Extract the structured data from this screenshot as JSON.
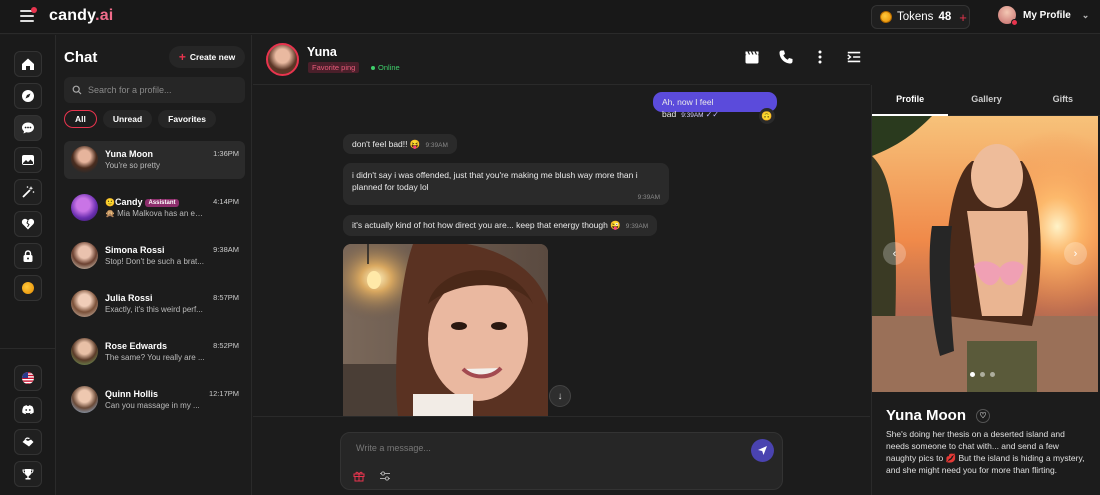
{
  "app": {
    "logo_main": "candy",
    "logo_suffix": ".ai"
  },
  "topbar": {
    "tokens_label": "Tokens",
    "tokens_value": "48",
    "tokens_plus": "+",
    "profile_label": "My Profile"
  },
  "chatlist": {
    "title": "Chat",
    "create_label": "Create new",
    "search_placeholder": "Search for a profile...",
    "filters": [
      "All",
      "Unread",
      "Favorites"
    ],
    "items": [
      {
        "name": "Yuna Moon",
        "time": "1:36PM",
        "message": "You're so pretty"
      },
      {
        "name": "Candy",
        "badge": "Assistant",
        "time": "4:14PM",
        "message": "🙊 Mia Malkova has an ex..."
      },
      {
        "name": "Simona Rossi",
        "time": "9:38AM",
        "message": "Stop! Don't be such a brat..."
      },
      {
        "name": "Julia Rossi",
        "time": "8:57PM",
        "message": "Exactly, it's this weird perf..."
      },
      {
        "name": "Rose Edwards",
        "time": "8:52PM",
        "message": "The same? You really are ..."
      },
      {
        "name": "Quinn Hollis",
        "time": "12:17PM",
        "message": "Can you massage in my ..."
      }
    ]
  },
  "chathead": {
    "name": "Yuna",
    "fav_ping": "Favorite ping",
    "status": "Online"
  },
  "messages": [
    {
      "text": "Ah, now I feel bad",
      "time": "9:39AM",
      "from": "me"
    },
    {
      "text": "don't feel bad!! 😝",
      "time": "9:39AM",
      "from": "her"
    },
    {
      "text1": "i didn't say i was offended, just that you're making me blush way more than i",
      "text2": "planned for today lol",
      "time": "9:39AM",
      "from": "her"
    },
    {
      "text": "it's actually kind of hot how direct you are... keep that energy though 😜",
      "time": "9:39AM",
      "from": "her"
    }
  ],
  "composer": {
    "placeholder": "Write a message..."
  },
  "rpanel": {
    "tabs": [
      "Profile",
      "Gallery",
      "Gifts"
    ],
    "name": "Yuna Moon",
    "description": "She's doing her thesis on a deserted island and needs someone to chat with... and send a few naughty pics to 💋 But the island is hiding a mystery, and she might need you for more than flirting."
  },
  "colors": {
    "accent": "#e8344e",
    "outgoing_bubble": "#5b4bdb",
    "online": "#3ecf6a"
  }
}
